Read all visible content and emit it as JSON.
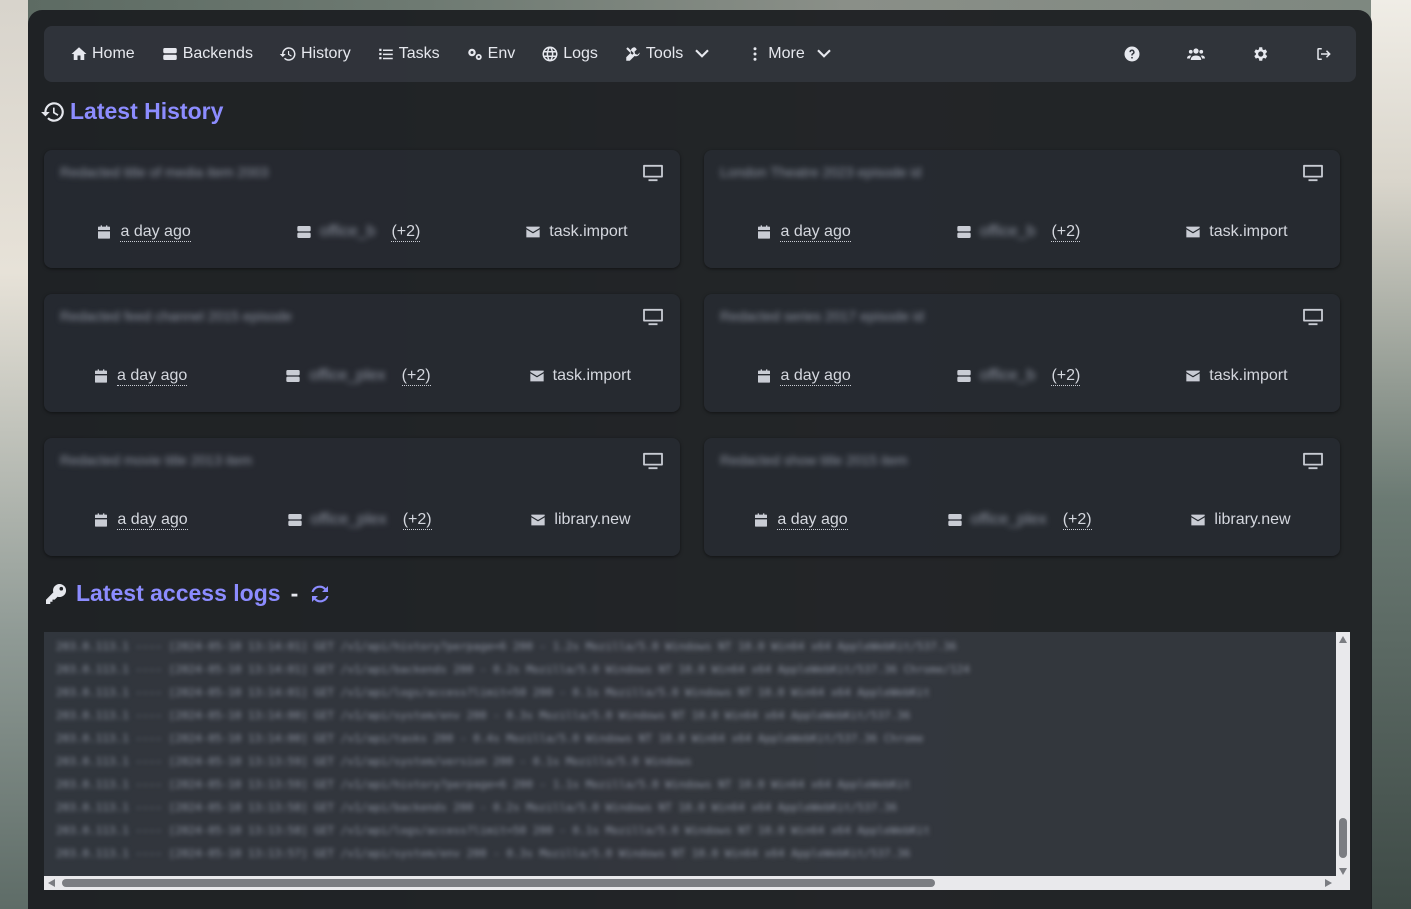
{
  "nav": {
    "home": "Home",
    "backends": "Backends",
    "history": "History",
    "tasks": "Tasks",
    "env": "Env",
    "logs": "Logs",
    "tools": "Tools",
    "more": "More"
  },
  "history_section": {
    "title": "Latest History"
  },
  "history_cards": [
    {
      "title": "Redacted title of media item 2003",
      "time": "a day ago",
      "backend": "office_b",
      "backend_extra": "(+2)",
      "event": "task.import",
      "icon": "monitor-icon"
    },
    {
      "title": "London Theatre 2023 episode id",
      "time": "a day ago",
      "backend": "office_b",
      "backend_extra": "(+2)",
      "event": "task.import",
      "icon": "monitor-icon"
    },
    {
      "title": "Redacted feed channel 2015 episode",
      "time": "a day ago",
      "backend": "office_plex",
      "backend_extra": "(+2)",
      "event": "task.import",
      "icon": "monitor-icon"
    },
    {
      "title": "Redacted series 2017 episode id",
      "time": "a day ago",
      "backend": "office_b",
      "backend_extra": "(+2)",
      "event": "task.import",
      "icon": "monitor-icon"
    },
    {
      "title": "Redacted movie title 2013 item",
      "time": "a day ago",
      "backend": "office_plex",
      "backend_extra": "(+2)",
      "event": "library.new",
      "icon": "monitor-icon"
    },
    {
      "title": "Redacted show title 2015 item",
      "time": "a day ago",
      "backend": "office_plex",
      "backend_extra": "(+2)",
      "event": "library.new",
      "icon": "monitor-icon"
    }
  ],
  "logs_section": {
    "title": "Latest access logs",
    "separator": "-"
  },
  "log_lines": [
    "203.0.113.1 ---- [2024-05-10 13:14:01] GET /v1/api/history?perpage=6 200 - 1.2s Mozilla/5.0 Windows NT 10.0 Win64 x64 AppleWebKit/537.36",
    "203.0.113.1 ---- [2024-05-10 13:14:01] GET /v1/api/backends 200 - 0.2s Mozilla/5.0 Windows NT 10.0 Win64 x64 AppleWebKit/537.36 Chrome/124",
    "203.0.113.1 ---- [2024-05-10 13:14:01] GET /v1/api/logs/access?limit=50 200 - 0.1s Mozilla/5.0 Windows NT 10.0 Win64 x64 AppleWebKit",
    "203.0.113.1 ---- [2024-05-10 13:14:00] GET /v1/api/system/env 200 - 0.3s Mozilla/5.0 Windows NT 10.0 Win64 x64 AppleWebKit/537.36",
    "203.0.113.1 ---- [2024-05-10 13:14:00] GET /v1/api/tasks 200 - 0.4s Mozilla/5.0 Windows NT 10.0 Win64 x64 AppleWebKit/537.36 Chrome",
    "203.0.113.1 ---- [2024-05-10 13:13:59] GET /v1/api/system/version 200 - 0.1s Mozilla/5.0 Windows",
    "203.0.113.1 ---- [2024-05-10 13:13:59] GET /v1/api/history?perpage=6 200 - 1.1s Mozilla/5.0 Windows NT 10.0 Win64 x64 AppleWebKit",
    "203.0.113.1 ---- [2024-05-10 13:13:58] GET /v1/api/backends 200 - 0.2s Mozilla/5.0 Windows NT 10.0 Win64 x64 AppleWebKit/537.36",
    "203.0.113.1 ---- [2024-05-10 13:13:58] GET /v1/api/logs/access?limit=50 200 - 0.1s Mozilla/5.0 Windows NT 10.0 Win64 x64 AppleWebKit",
    "203.0.113.1 ---- [2024-05-10 13:13:57] GET /v1/api/system/env 200 - 0.3s Mozilla/5.0 Windows NT 10.0 Win64 x64 AppleWebKit/537.36"
  ],
  "colors": {
    "accent": "#8c8cff",
    "panel": "#1a1c20",
    "card": "#282c34",
    "text": "#d9dce3"
  }
}
